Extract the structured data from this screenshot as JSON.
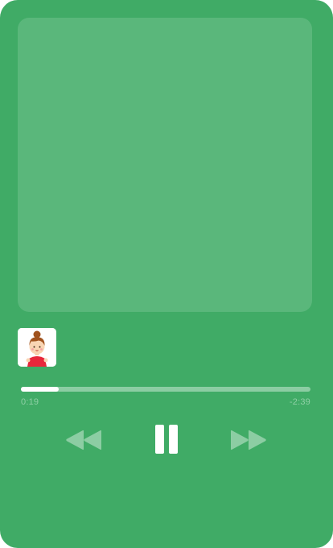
{
  "player": {
    "artwork": {
      "label": ""
    },
    "track": {
      "avatar_icon": "cartoon-girl-avatar-icon"
    },
    "progress": {
      "fraction": 0.13,
      "elapsed": "0:19",
      "remaining": "-2:39"
    },
    "controls": {
      "rewind_icon": "rewind-icon",
      "pause_icon": "pause-icon",
      "forward_icon": "fast-forward-icon"
    }
  },
  "colors": {
    "background": "#40ab66",
    "artwork": "#5ab77b",
    "progress_track": "#8ccda3",
    "progress_fill": "#ffffff",
    "time_text": "#8fd0a6",
    "control_dim": "#8ccda3",
    "control_active": "#ffffff"
  }
}
